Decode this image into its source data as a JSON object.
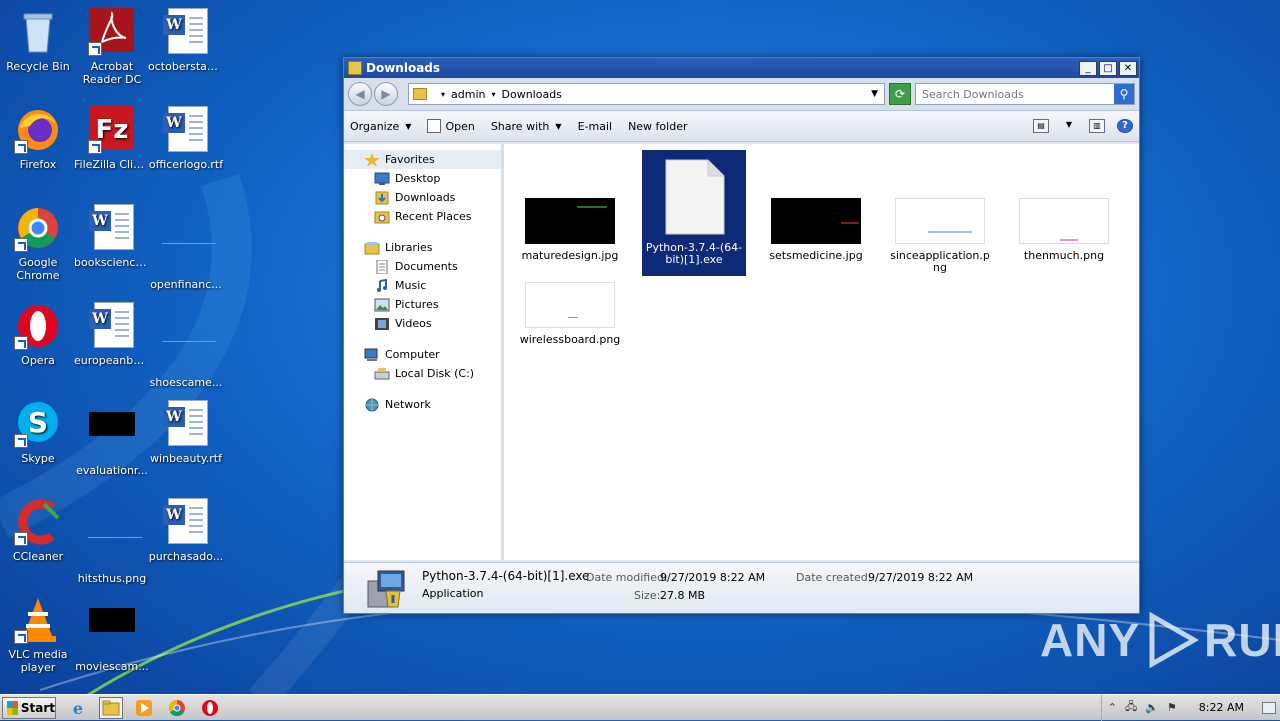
{
  "desktop": {
    "icons": [
      {
        "label": "Recycle Bin"
      },
      {
        "label": "Acrobat Reader DC"
      },
      {
        "label": "octoberstan..."
      },
      {
        "label": "Firefox"
      },
      {
        "label": "FileZilla Client"
      },
      {
        "label": "officerlogo.rtf"
      },
      {
        "label": "Google Chrome"
      },
      {
        "label": "bookscience..."
      },
      {
        "label": "openfinanc..."
      },
      {
        "label": "Opera"
      },
      {
        "label": "europeanbe..."
      },
      {
        "label": "shoescame..."
      },
      {
        "label": "Skype"
      },
      {
        "label": "evaluationr..."
      },
      {
        "label": "winbeauty.rtf"
      },
      {
        "label": "CCleaner"
      },
      {
        "label": "hitsthus.png"
      },
      {
        "label": "purchasado..."
      },
      {
        "label": "VLC media player"
      },
      {
        "label": "moviescam..."
      }
    ]
  },
  "window": {
    "title": "Downloads",
    "minimize": "_",
    "maximize": "□",
    "close": "✕",
    "address": {
      "segment1": "admin",
      "segment2": "Downloads"
    },
    "search": {
      "placeholder": "Search Downloads"
    },
    "toolbar": {
      "organize": "Organize",
      "open": "Open",
      "share_with": "Share with",
      "email": "E-mail",
      "new_folder": "New folder"
    },
    "nav": {
      "favorites": "Favorites",
      "desktop": "Desktop",
      "downloads": "Downloads",
      "recent_places": "Recent Places",
      "libraries": "Libraries",
      "documents": "Documents",
      "music": "Music",
      "pictures": "Pictures",
      "videos": "Videos",
      "computer": "Computer",
      "local_disk": "Local Disk (C:)",
      "network": "Network"
    },
    "files": [
      {
        "name": "maturedesign.jpg"
      },
      {
        "name": "Python-3.7.4-(64-bit)[1].exe"
      },
      {
        "name": "setsmedicine.jpg"
      },
      {
        "name": "sinceapplication.png"
      },
      {
        "name": "thenmuch.png"
      },
      {
        "name": "wirelessboard.png"
      }
    ],
    "status": {
      "filename": "Python-3.7.4-(64-bit)[1].exe",
      "type": "Application",
      "date_modified_label": "Date modified:",
      "date_modified": "9/27/2019 8:22 AM",
      "date_created_label": "Date created:",
      "date_created": "9/27/2019 8:22 AM",
      "size_label": "Size:",
      "size": "27.8 MB"
    }
  },
  "taskbar": {
    "start": "Start",
    "clock": "8:22 AM"
  },
  "watermark": {
    "left": "ANY",
    "right": "RUN"
  }
}
